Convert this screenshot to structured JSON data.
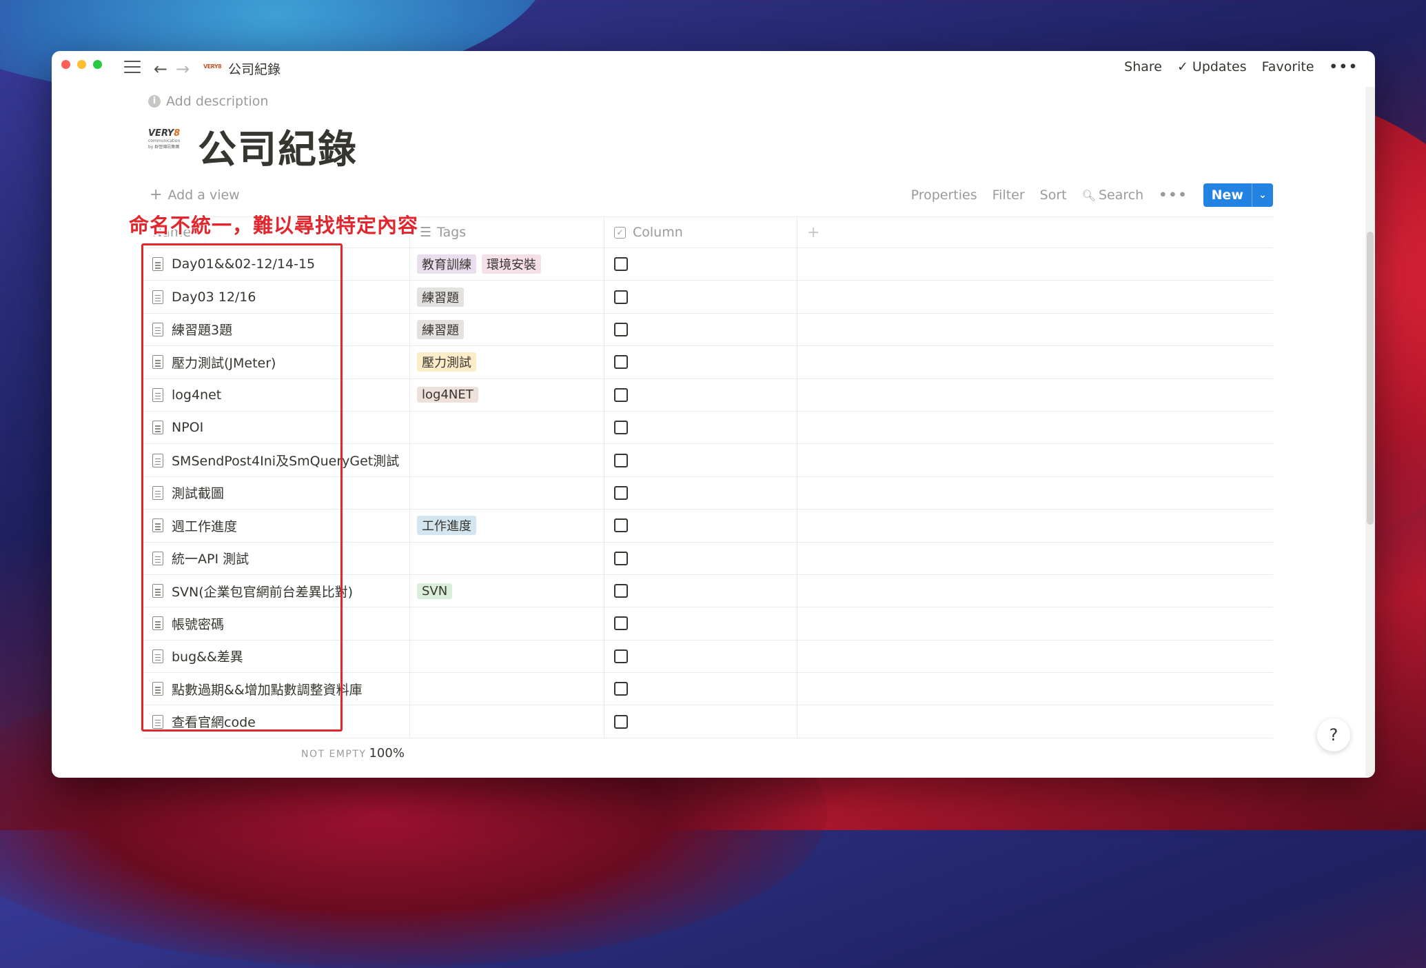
{
  "topbar": {
    "breadcrumb_title": "公司紀錄",
    "breadcrumb_logo": "VERY8",
    "share": "Share",
    "updates": "Updates",
    "favorite": "Favorite",
    "more": "•••"
  },
  "page": {
    "add_description": "Add description",
    "logo": {
      "very": "VERY",
      "eight": "8",
      "sub": "communication by 群營傳訊集團"
    },
    "title": "公司紀錄"
  },
  "view": {
    "add_view": "Add a view",
    "properties": "Properties",
    "filter": "Filter",
    "sort": "Sort",
    "search": "Search",
    "more": "•••",
    "new": "New"
  },
  "annotation": "命名不統一，難以尋找特定內容",
  "table": {
    "columns": {
      "name": "Name",
      "tags": "Tags",
      "column": "Column"
    },
    "rows": [
      {
        "name": "Day01&&02-12/14-15",
        "tags": [
          {
            "label": "教育訓練",
            "color": "#e8deee"
          },
          {
            "label": "環境安裝",
            "color": "#f5e0e9"
          }
        ]
      },
      {
        "name": "Day03 12/16",
        "tags": [
          {
            "label": "練習題",
            "color": "#e3e2e0"
          }
        ]
      },
      {
        "name": "練習題3題",
        "tags": [
          {
            "label": "練習題",
            "color": "#e3e2e0"
          }
        ]
      },
      {
        "name": "壓力測試(JMeter)",
        "tags": [
          {
            "label": "壓力測試",
            "color": "#fdecc8"
          }
        ]
      },
      {
        "name": "log4net",
        "tags": [
          {
            "label": "log4NET",
            "color": "#eee0da"
          }
        ]
      },
      {
        "name": "NPOI",
        "tags": []
      },
      {
        "name": "SMSendPost4Ini及SmQueryGet測試",
        "tags": []
      },
      {
        "name": "測試截圖",
        "tags": []
      },
      {
        "name": "週工作進度",
        "tags": [
          {
            "label": "工作進度",
            "color": "#d3e5ef"
          }
        ]
      },
      {
        "name": "統一API 測試",
        "tags": []
      },
      {
        "name": "SVN(企業包官網前台差異比對)",
        "tags": [
          {
            "label": "SVN",
            "color": "#dbeddb"
          }
        ]
      },
      {
        "name": "帳號密碼",
        "tags": []
      },
      {
        "name": "bug&&差異",
        "tags": []
      },
      {
        "name": "點數過期&&增加點數調整資料庫",
        "tags": []
      },
      {
        "name": "查看官網code",
        "tags": []
      }
    ]
  },
  "footer": {
    "label": "NOT EMPTY",
    "value": "100%"
  },
  "help": "?",
  "colors": {
    "accent": "#2383e2",
    "annotation": "#e1262e"
  }
}
